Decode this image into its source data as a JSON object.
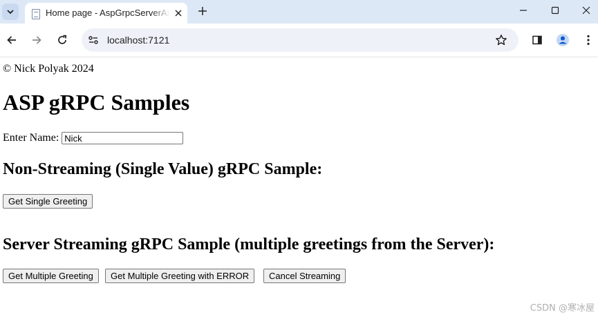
{
  "browser": {
    "tab_title": "Home page - AspGrpcServerAndClient",
    "url": "localhost:7121"
  },
  "page": {
    "copyright": "© Nick Polyak 2024",
    "heading": "ASP gRPC Samples",
    "name_label": "Enter Name:",
    "name_value": "Nick",
    "single_heading": "Non-Streaming (Single Value) gRPC Sample:",
    "single_button": "Get Single Greeting",
    "stream_heading": "Server Streaming gRPC Sample (multiple greetings from the Server):",
    "stream_buttons": {
      "multiple": "Get Multiple Greeting",
      "multiple_error": "Get Multiple Greeting with ERROR",
      "cancel": "Cancel Streaming"
    }
  },
  "watermark": "CSDN @寒冰屋"
}
